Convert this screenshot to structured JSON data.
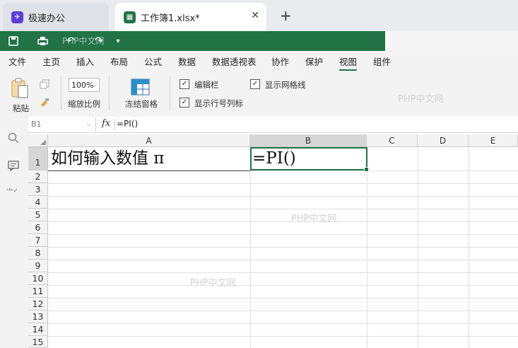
{
  "tabs": [
    {
      "label": "极速办公",
      "icon": "rocket-icon"
    },
    {
      "label": "工作簿1.xlsx*",
      "icon": "spreadsheet-icon"
    }
  ],
  "title_toolbar": {
    "hint_text": "PHP中文网"
  },
  "menu": [
    "文件",
    "主页",
    "插入",
    "布局",
    "公式",
    "数据",
    "数据透视表",
    "协作",
    "保护",
    "视图",
    "组件"
  ],
  "ribbon": {
    "paste_label": "粘贴",
    "zoom_value": "100%",
    "zoom_label": "缩放比例",
    "freeze_label": "冻结窗格",
    "formula_bar_label": "编辑栏",
    "gridlines_label": "显示网格线",
    "headings_label": "显示行号列标"
  },
  "formula_bar": {
    "cell_ref": "B1",
    "fx": "fx",
    "content": "=PI()"
  },
  "columns": [
    "A",
    "B",
    "C",
    "D",
    "E"
  ],
  "rows": [
    "1",
    "2",
    "3",
    "4",
    "5",
    "6",
    "7",
    "8",
    "9",
    "10",
    "11",
    "12",
    "13",
    "14",
    "15"
  ],
  "cells": {
    "A1": "如何输入数值 π",
    "B1": "=PI()"
  },
  "watermarks": [
    "PHP中文网",
    "PHP中文网",
    "PHP中文网"
  ],
  "colors": {
    "brand_green": "#217346",
    "selection_green": "#217346"
  }
}
